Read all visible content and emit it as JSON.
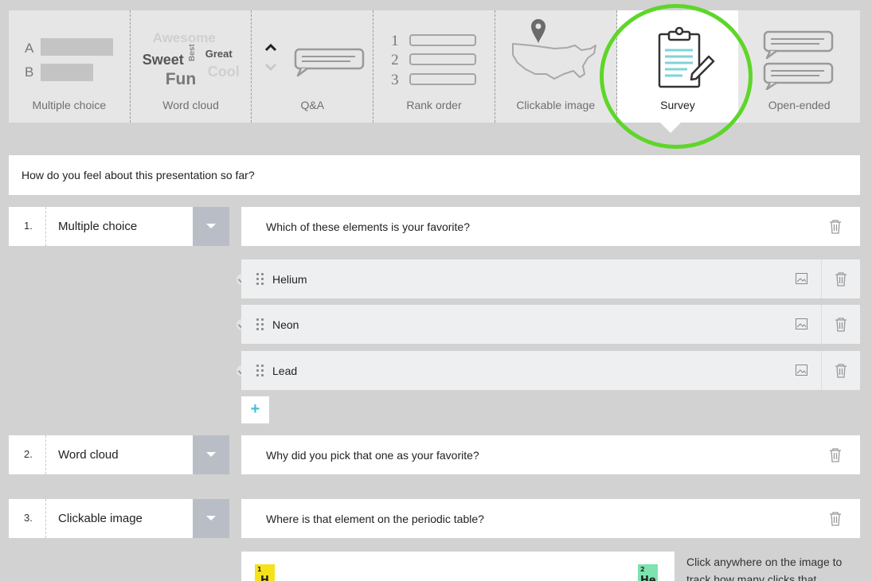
{
  "toolbar": {
    "items": [
      {
        "label": "Multiple choice",
        "icon": "multiple-choice-icon",
        "active": false
      },
      {
        "label": "Word cloud",
        "icon": "word-cloud-icon",
        "active": false
      },
      {
        "label": "Q&A",
        "icon": "qa-icon",
        "active": false
      },
      {
        "label": "Rank order",
        "icon": "rank-order-icon",
        "active": false
      },
      {
        "label": "Clickable image",
        "icon": "map-pin-icon",
        "active": false
      },
      {
        "label": "Survey",
        "icon": "clipboard-icon",
        "active": true
      },
      {
        "label": "Open-ended",
        "icon": "speech-bubbles-icon",
        "active": false
      }
    ],
    "mc_letters": [
      "A",
      "B"
    ],
    "word_cloud": {
      "w1": "Awesome",
      "w2": "Sweet",
      "w3": "Best",
      "w4": "Great",
      "w5": "Fun",
      "w6": "Cool"
    },
    "rank_numbers": [
      "1",
      "2",
      "3"
    ],
    "highlight_color": "#5ed629"
  },
  "survey": {
    "title": "How do you feel about this presentation so far?",
    "questions": [
      {
        "number": "1.",
        "type": "Multiple choice",
        "text": "Which of these elements is your favorite?",
        "options": [
          "Helium",
          "Neon",
          "Lead"
        ]
      },
      {
        "number": "2.",
        "type": "Word cloud",
        "text": "Why did you pick that one as your favorite?"
      },
      {
        "number": "3.",
        "type": "Clickable image",
        "text": "Where is that element on the periodic table?",
        "image_tiles": [
          {
            "number": "1",
            "symbol": "H",
            "color": "#f5e21a"
          },
          {
            "number": "2",
            "symbol": "He",
            "color": "#7de3b0"
          }
        ],
        "note": "Click anywhere on the image to track how many clicks that"
      }
    ]
  },
  "colors": {
    "accent": "#44c2cf",
    "dropdown": "#b9bec6"
  }
}
